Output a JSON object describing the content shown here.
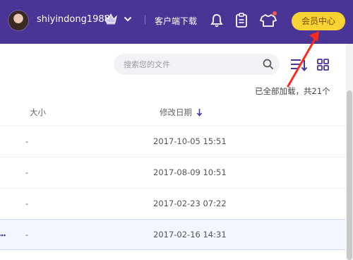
{
  "header": {
    "username": "shiyindong1988",
    "client_download": "客户端下载",
    "vip_center": "会员中心",
    "icons": [
      "avatar",
      "crown-icon",
      "chevron-down-icon",
      "bell-icon",
      "clipboard-icon",
      "tshirt-icon"
    ],
    "colors": {
      "bar": "#4a3496",
      "vip_button": "#f9d234",
      "notification_dot": "#f05a4a"
    }
  },
  "toolbar": {
    "search_placeholder": "搜索您的文件",
    "icons": [
      "search-icon",
      "sort-icon",
      "grid-view-icon"
    ]
  },
  "status": {
    "loaded": "已全部加载，共21个"
  },
  "table": {
    "columns": {
      "size": "大小",
      "date": "修改日期"
    },
    "sort": {
      "column": "date",
      "direction": "desc"
    },
    "rows": [
      {
        "size": "-",
        "date": "2017-10-05 15:51",
        "selected": false
      },
      {
        "size": "-",
        "date": "2017-08-09 10:51",
        "selected": false
      },
      {
        "size": "-",
        "date": "2017-02-23 07:22",
        "selected": false
      },
      {
        "size": "-",
        "date": "2017-02-16 14:31",
        "selected": true
      }
    ]
  },
  "annotation": {
    "color": "#ff2a1a",
    "points_to": "vip-center-button"
  }
}
